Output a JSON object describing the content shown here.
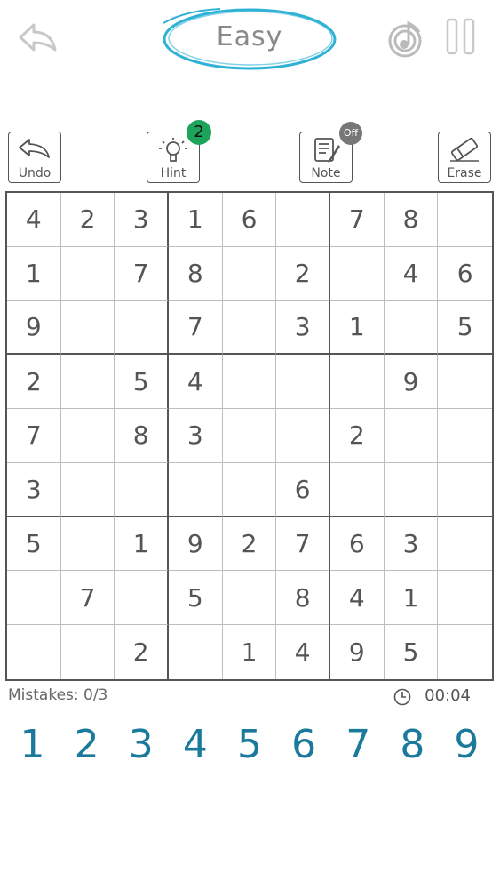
{
  "header": {
    "title": "Easy",
    "accent": "#2fb2d6"
  },
  "toolbar": {
    "undo_label": "Undo",
    "hint_label": "Hint",
    "hint_count": "2",
    "note_label": "Note",
    "note_state": "Off",
    "erase_label": "Erase",
    "hint_badge_color": "#1ca45a"
  },
  "board": {
    "rows": [
      [
        "4",
        "2",
        "3",
        "1",
        "6",
        "",
        "7",
        "8",
        ""
      ],
      [
        "1",
        "",
        "7",
        "8",
        "",
        "2",
        "",
        "4",
        "6"
      ],
      [
        "9",
        "",
        "",
        "7",
        "",
        "3",
        "1",
        "",
        "5"
      ],
      [
        "2",
        "",
        "5",
        "4",
        "",
        "",
        "",
        "9",
        ""
      ],
      [
        "7",
        "",
        "8",
        "3",
        "",
        "",
        "2",
        "",
        ""
      ],
      [
        "3",
        "",
        "",
        "",
        "",
        "6",
        "",
        "",
        ""
      ],
      [
        "5",
        "",
        "1",
        "9",
        "2",
        "7",
        "6",
        "3",
        ""
      ],
      [
        "",
        "7",
        "",
        "5",
        "",
        "8",
        "4",
        "1",
        ""
      ],
      [
        "",
        "",
        "2",
        "",
        "1",
        "4",
        "9",
        "5",
        ""
      ]
    ]
  },
  "status": {
    "mistakes": "Mistakes: 0/3",
    "timer": "00:04"
  },
  "numpad": [
    "1",
    "2",
    "3",
    "4",
    "5",
    "6",
    "7",
    "8",
    "9"
  ],
  "numpad_color": "#1b7a9c"
}
